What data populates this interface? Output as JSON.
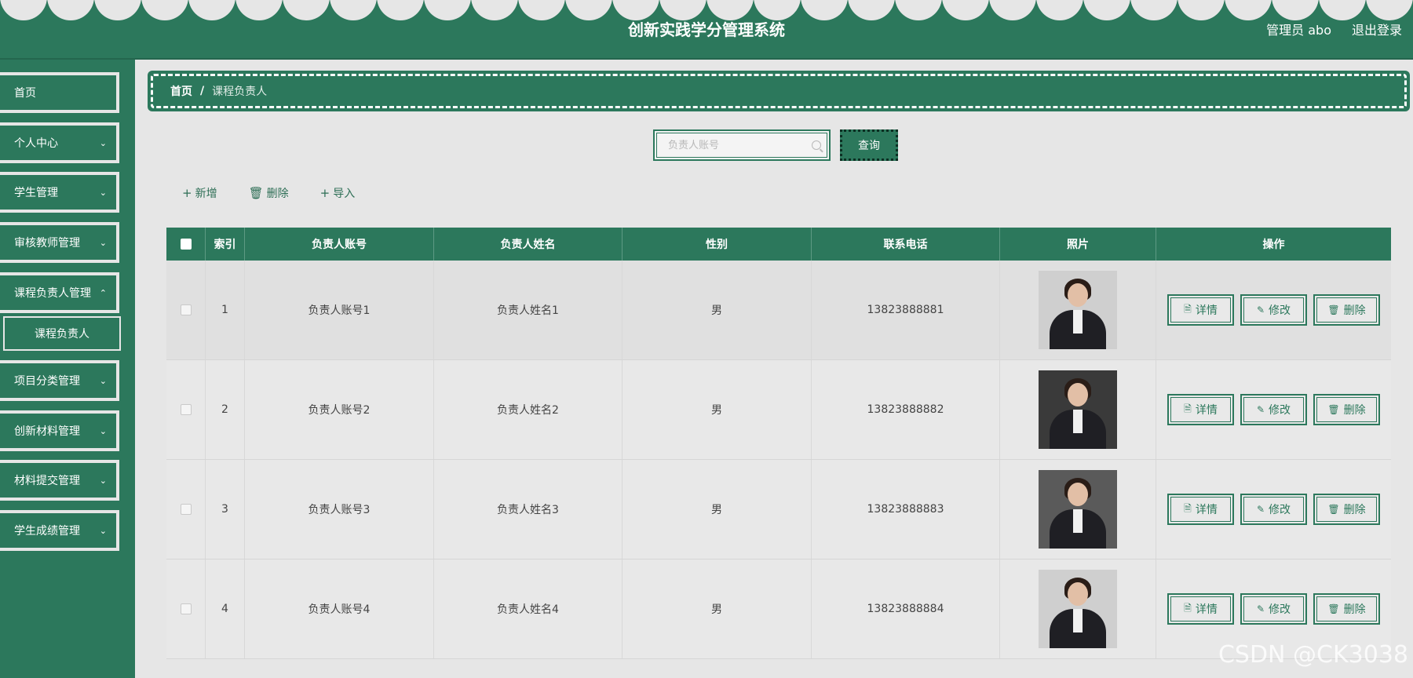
{
  "header": {
    "title": "创新实践学分管理系统",
    "user": "管理员 abo",
    "logout": "退出登录"
  },
  "sidebar": {
    "items": [
      {
        "label": "首页"
      },
      {
        "label": "个人中心"
      },
      {
        "label": "学生管理"
      },
      {
        "label": "审核教师管理"
      },
      {
        "label": "课程负责人管理"
      },
      {
        "label": "项目分类管理"
      },
      {
        "label": "创新材料管理"
      },
      {
        "label": "材料提交管理"
      },
      {
        "label": "学生成绩管理"
      }
    ],
    "sub_item": "课程负责人"
  },
  "breadcrumb": {
    "home": "首页",
    "sep": "/",
    "current": "课程负责人"
  },
  "search": {
    "placeholder": "负责人账号",
    "button": "查询"
  },
  "actions": {
    "add": "新增",
    "delete": "删除",
    "import": "导入"
  },
  "table": {
    "headers": [
      "索引",
      "负责人账号",
      "负责人姓名",
      "性别",
      "联系电话",
      "照片",
      "操作"
    ],
    "rows": [
      {
        "index": "1",
        "account": "负责人账号1",
        "name": "负责人姓名1",
        "gender": "男",
        "phone": "13823888881"
      },
      {
        "index": "2",
        "account": "负责人账号2",
        "name": "负责人姓名2",
        "gender": "男",
        "phone": "13823888882"
      },
      {
        "index": "3",
        "account": "负责人账号3",
        "name": "负责人姓名3",
        "gender": "男",
        "phone": "13823888883"
      },
      {
        "index": "4",
        "account": "负责人账号4",
        "name": "负责人姓名4",
        "gender": "男",
        "phone": "13823888884"
      }
    ],
    "op_labels": {
      "detail": "详情",
      "edit": "修改",
      "delete": "删除"
    }
  },
  "watermark": "CSDN @CK3038",
  "colors": {
    "primary": "#2c785c",
    "background": "#e6e6e6"
  }
}
